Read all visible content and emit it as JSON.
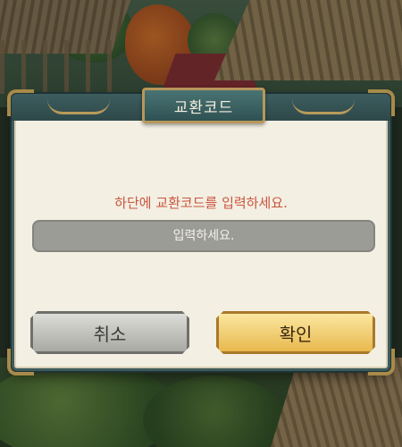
{
  "dialog": {
    "title": "교환코드",
    "prompt": "하단에 교환코드를 입력하세요.",
    "input": {
      "value": "",
      "placeholder": "입력하세요."
    },
    "cancel_label": "취소",
    "confirm_label": "확인"
  },
  "colors": {
    "panel": "#f3efe3",
    "frame": "#3e5b5c",
    "prompt_text": "#c9553e",
    "confirm_button": "#e8b84d",
    "cancel_button": "#a9a9a4"
  }
}
